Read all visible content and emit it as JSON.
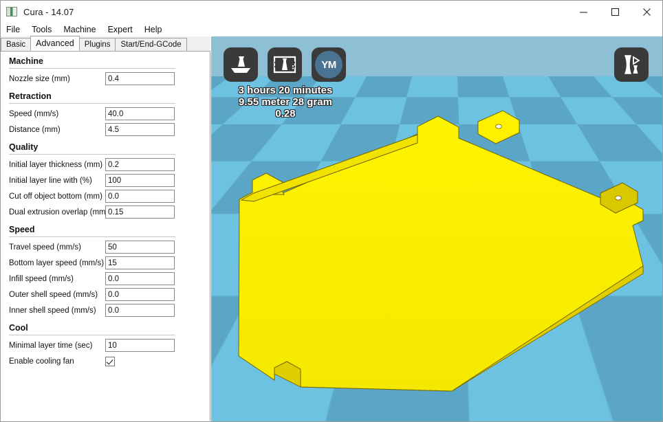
{
  "window": {
    "title": "Cura - 14.07",
    "app_icon": "cura-app-icon",
    "controls": {
      "minimize": "—",
      "maximize": "☐",
      "close": "✕"
    }
  },
  "menubar": {
    "items": [
      {
        "label": "File"
      },
      {
        "label": "Tools"
      },
      {
        "label": "Machine"
      },
      {
        "label": "Expert"
      },
      {
        "label": "Help"
      }
    ]
  },
  "tabs": [
    {
      "label": "Basic",
      "active": false
    },
    {
      "label": "Advanced",
      "active": true
    },
    {
      "label": "Plugins",
      "active": false
    },
    {
      "label": "Start/End-GCode",
      "active": false
    }
  ],
  "settings": {
    "sections": [
      {
        "title": "Machine",
        "rows": [
          {
            "label": "Nozzle size (mm)",
            "value": "0.4",
            "type": "text"
          }
        ]
      },
      {
        "title": "Retraction",
        "rows": [
          {
            "label": "Speed (mm/s)",
            "value": "40.0",
            "type": "text"
          },
          {
            "label": "Distance (mm)",
            "value": "4.5",
            "type": "text"
          }
        ]
      },
      {
        "title": "Quality",
        "rows": [
          {
            "label": "Initial layer thickness (mm)",
            "value": "0.2",
            "type": "text"
          },
          {
            "label": "Initial layer line with (%)",
            "value": "100",
            "type": "text"
          },
          {
            "label": "Cut off object bottom (mm)",
            "value": "0.0",
            "type": "text"
          },
          {
            "label": "Dual extrusion overlap (mm)",
            "value": "0.15",
            "type": "text"
          }
        ]
      },
      {
        "title": "Speed",
        "rows": [
          {
            "label": "Travel speed (mm/s)",
            "value": "50",
            "type": "text"
          },
          {
            "label": "Bottom layer speed (mm/s)",
            "value": "15",
            "type": "text"
          },
          {
            "label": "Infill speed (mm/s)",
            "value": "0.0",
            "type": "text"
          },
          {
            "label": "Outer shell speed (mm/s)",
            "value": "0.0",
            "type": "text"
          },
          {
            "label": "Inner shell speed (mm/s)",
            "value": "0.0",
            "type": "text"
          }
        ]
      },
      {
        "title": "Cool",
        "rows": [
          {
            "label": "Minimal layer time (sec)",
            "value": "10",
            "type": "text"
          },
          {
            "label": "Enable cooling fan",
            "value": "",
            "type": "checkbox",
            "checked": true
          }
        ]
      }
    ]
  },
  "viewport": {
    "toolbar": [
      {
        "name": "load-model-button",
        "icon": "load-model-icon"
      },
      {
        "name": "layer-view-button",
        "icon": "layer-view-icon"
      },
      {
        "name": "youmagine-button",
        "icon": "youmagine-icon",
        "label": "YM"
      }
    ],
    "expert_button": {
      "name": "expert-config-button",
      "icon": "expert-config-icon"
    },
    "info": {
      "time": "3 hours 20 minutes",
      "material": "9.55 meter 28 gram",
      "cost": "0.28"
    },
    "model": {
      "name": "yellow-plate-model",
      "color": "#FFF000"
    },
    "colors": {
      "background": "#8DC0D5",
      "plate_light": "#6DC2E2",
      "plate_dark": "#5BA6C6"
    }
  }
}
